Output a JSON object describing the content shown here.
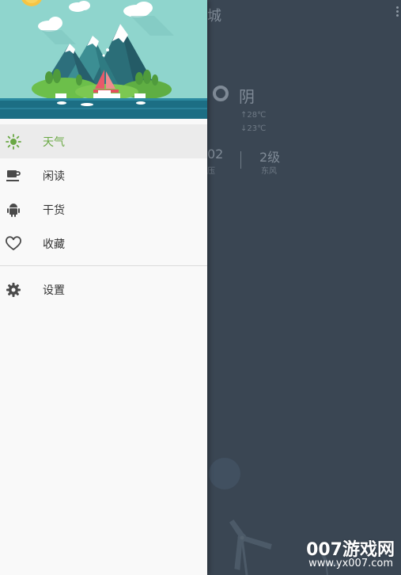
{
  "background": {
    "city_title": "城",
    "condition": "阴",
    "temp_high": "↑28℃",
    "temp_low": "↓23℃",
    "pressure_value": "02",
    "pressure_label": "压",
    "wind_level": "2级",
    "wind_direction": "东风"
  },
  "drawer": {
    "menu_items": [
      {
        "label": "天气",
        "icon": "sun-icon",
        "active": true
      },
      {
        "label": "闲读",
        "icon": "coffee-cup-icon",
        "active": false
      },
      {
        "label": "干货",
        "icon": "android-icon",
        "active": false
      },
      {
        "label": "收藏",
        "icon": "heart-icon",
        "active": false
      }
    ],
    "settings": {
      "label": "设置",
      "icon": "gear-icon"
    }
  },
  "watermark": {
    "brand": "007游戏网",
    "url": "www.yx007.com"
  },
  "colors": {
    "accent_green": "#6aa844",
    "app_background": "#3a4653",
    "drawer_background": "#f9f9f9",
    "header_sky": "#8fd5cd",
    "water": "#1c6e84"
  }
}
